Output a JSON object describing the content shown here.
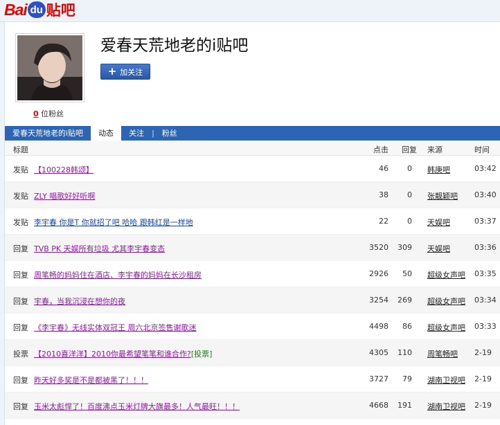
{
  "logo": {
    "bai": "Bai",
    "du": "du",
    "tieba": "贴吧"
  },
  "profile": {
    "title": "爱春天荒地老的i贴吧",
    "follow_label": "加关注",
    "fans_count": "0",
    "fans_label": "位粉丝"
  },
  "nav": {
    "items": [
      {
        "label": "爱春天荒地老的i贴吧"
      },
      {
        "label": "动态"
      },
      {
        "label": "关注"
      },
      {
        "label": "粉丝"
      }
    ],
    "separator": "|"
  },
  "table": {
    "headers": {
      "title": "标题",
      "clicks": "点击",
      "replies": "回复",
      "source": "来源",
      "time": "时间"
    },
    "rows": [
      {
        "type": "发贴",
        "title": "【100228韩颂】",
        "tag": "",
        "clicks": "46",
        "replies": "0",
        "source": "韩庚吧",
        "time": "03:42"
      },
      {
        "type": "发贴",
        "title": "ZLY 唱歌好好听啊",
        "tag": "",
        "clicks": "38",
        "replies": "0",
        "source": "张靓颖吧",
        "time": "03:40"
      },
      {
        "type": "发贴",
        "title": "李宇春 你是T 你就招了吧 哈哈 跟韩红是一样地",
        "tag": "",
        "clicks": "22",
        "replies": "0",
        "source": "天娱吧",
        "time": "03:37"
      },
      {
        "type": "回复",
        "title": "TVB PK 天娱所有垃圾 尤其李宇春变态",
        "tag": "",
        "clicks": "3520",
        "replies": "309",
        "source": "天娱吧",
        "time": "03:36"
      },
      {
        "type": "回复",
        "title": "周笔畅的妈妈住在酒店、李宇春的妈妈在长沙租房",
        "tag": "",
        "clicks": "2926",
        "replies": "50",
        "source": "超级女声吧",
        "time": "03:35"
      },
      {
        "type": "回复",
        "title": "宇春，当我沉浸在想你的夜",
        "tag": "",
        "clicks": "3254",
        "replies": "269",
        "source": "超级女声吧",
        "time": "03:34"
      },
      {
        "type": "回复",
        "title": "《李宇春》无线实体双冠王 周六北京签售谢歌迷",
        "tag": "",
        "clicks": "4498",
        "replies": "86",
        "source": "超级女声吧",
        "time": "03:33"
      },
      {
        "type": "投票",
        "title": "【2010喜洋洋】2010你最希望笔笔和谁合作?",
        "tag": "[投票]",
        "clicks": "4305",
        "replies": "110",
        "source": "周笔畅吧",
        "time": "2-19"
      },
      {
        "type": "回复",
        "title": "昨天好多奖是不是都被黑了！！！",
        "tag": "",
        "clicks": "3727",
        "replies": "79",
        "source": "湖南卫视吧",
        "time": "2-19"
      },
      {
        "type": "回复",
        "title": "玉米太彪悍了！百度沸点玉米灯牌大旗最多！人气最旺！！！",
        "tag": "",
        "clicks": "4668",
        "replies": "191",
        "source": "湖南卫视吧",
        "time": "2-19"
      }
    ]
  }
}
